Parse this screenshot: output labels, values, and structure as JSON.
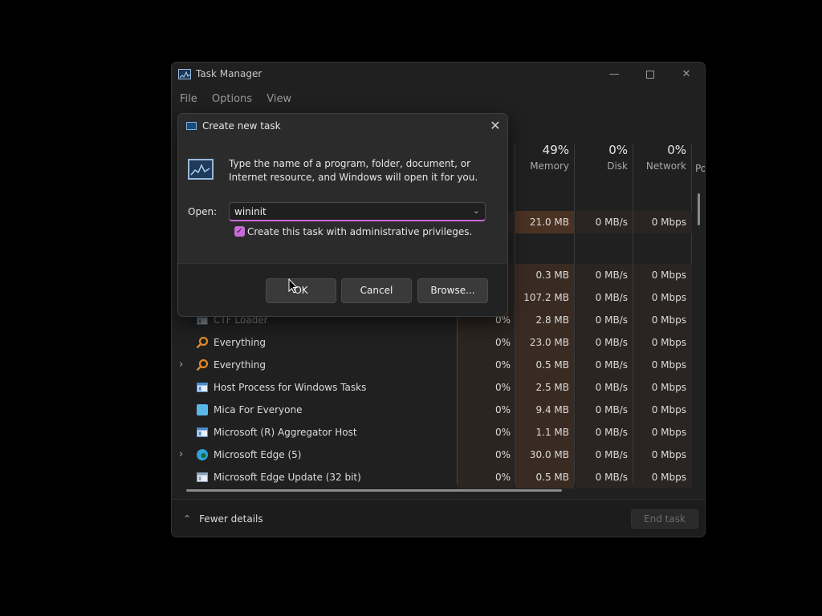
{
  "window": {
    "title": "Task Manager",
    "menu": [
      "File",
      "Options",
      "View"
    ]
  },
  "columns": {
    "memory": {
      "pct": "49%",
      "label": "Memory"
    },
    "disk": {
      "pct": "0%",
      "label": "Disk"
    },
    "network": {
      "pct": "0%",
      "label": "Network"
    },
    "power_partial": "Po"
  },
  "rows": [
    {
      "name": "",
      "cpu": "",
      "memory": "21.0 MB",
      "disk": "0 MB/s",
      "network": "0 Mbps",
      "icon": "app-icon",
      "chevron": false
    },
    {
      "name": "",
      "cpu": "",
      "memory": "0.3 MB",
      "disk": "0 MB/s",
      "network": "0 Mbps",
      "icon": "app-icon",
      "chevron": false
    },
    {
      "name": "",
      "cpu": "",
      "memory": "107.2 MB",
      "disk": "0 MB/s",
      "network": "0 Mbps",
      "icon": "app-icon",
      "chevron": false
    },
    {
      "name": "CTF Loader",
      "cpu": "0%",
      "memory": "2.8 MB",
      "disk": "0 MB/s",
      "network": "0 Mbps",
      "icon": "ctf-loader-icon",
      "chevron": false
    },
    {
      "name": "Everything",
      "cpu": "0%",
      "memory": "23.0 MB",
      "disk": "0 MB/s",
      "network": "0 Mbps",
      "icon": "everything-search-icon",
      "chevron": false
    },
    {
      "name": "Everything",
      "cpu": "0%",
      "memory": "0.5 MB",
      "disk": "0 MB/s",
      "network": "0 Mbps",
      "icon": "everything-search-icon",
      "chevron": true
    },
    {
      "name": "Host Process for Windows Tasks",
      "cpu": "0%",
      "memory": "2.5 MB",
      "disk": "0 MB/s",
      "network": "0 Mbps",
      "icon": "window-app-icon",
      "chevron": false
    },
    {
      "name": "Mica For Everyone",
      "cpu": "0%",
      "memory": "9.4 MB",
      "disk": "0 MB/s",
      "network": "0 Mbps",
      "icon": "mica-icon",
      "chevron": false
    },
    {
      "name": "Microsoft (R) Aggregator Host",
      "cpu": "0%",
      "memory": "1.1 MB",
      "disk": "0 MB/s",
      "network": "0 Mbps",
      "icon": "window-app-icon",
      "chevron": false
    },
    {
      "name": "Microsoft Edge (5)",
      "cpu": "0%",
      "memory": "30.0 MB",
      "disk": "0 MB/s",
      "network": "0 Mbps",
      "icon": "edge-icon",
      "chevron": true
    },
    {
      "name": "Microsoft Edge Update (32 bit)",
      "cpu": "0%",
      "memory": "0.5 MB",
      "disk": "0 MB/s",
      "network": "0 Mbps",
      "icon": "edge-update-icon",
      "chevron": false
    }
  ],
  "footer": {
    "fewer_details": "Fewer details",
    "end_task": "End task"
  },
  "dialog": {
    "title": "Create new task",
    "message": "Type the name of a program, folder, document, or Internet resource, and Windows will open it for you.",
    "open_label": "Open:",
    "open_value": "wininit",
    "admin_checkbox_label": "Create this task with administrative privileges.",
    "admin_checked": true,
    "ok": "OK",
    "cancel": "Cancel",
    "browse": "Browse..."
  },
  "colors": {
    "accent": "#c86ad8",
    "background": "#202020",
    "dialog": "#2b2b2b"
  }
}
